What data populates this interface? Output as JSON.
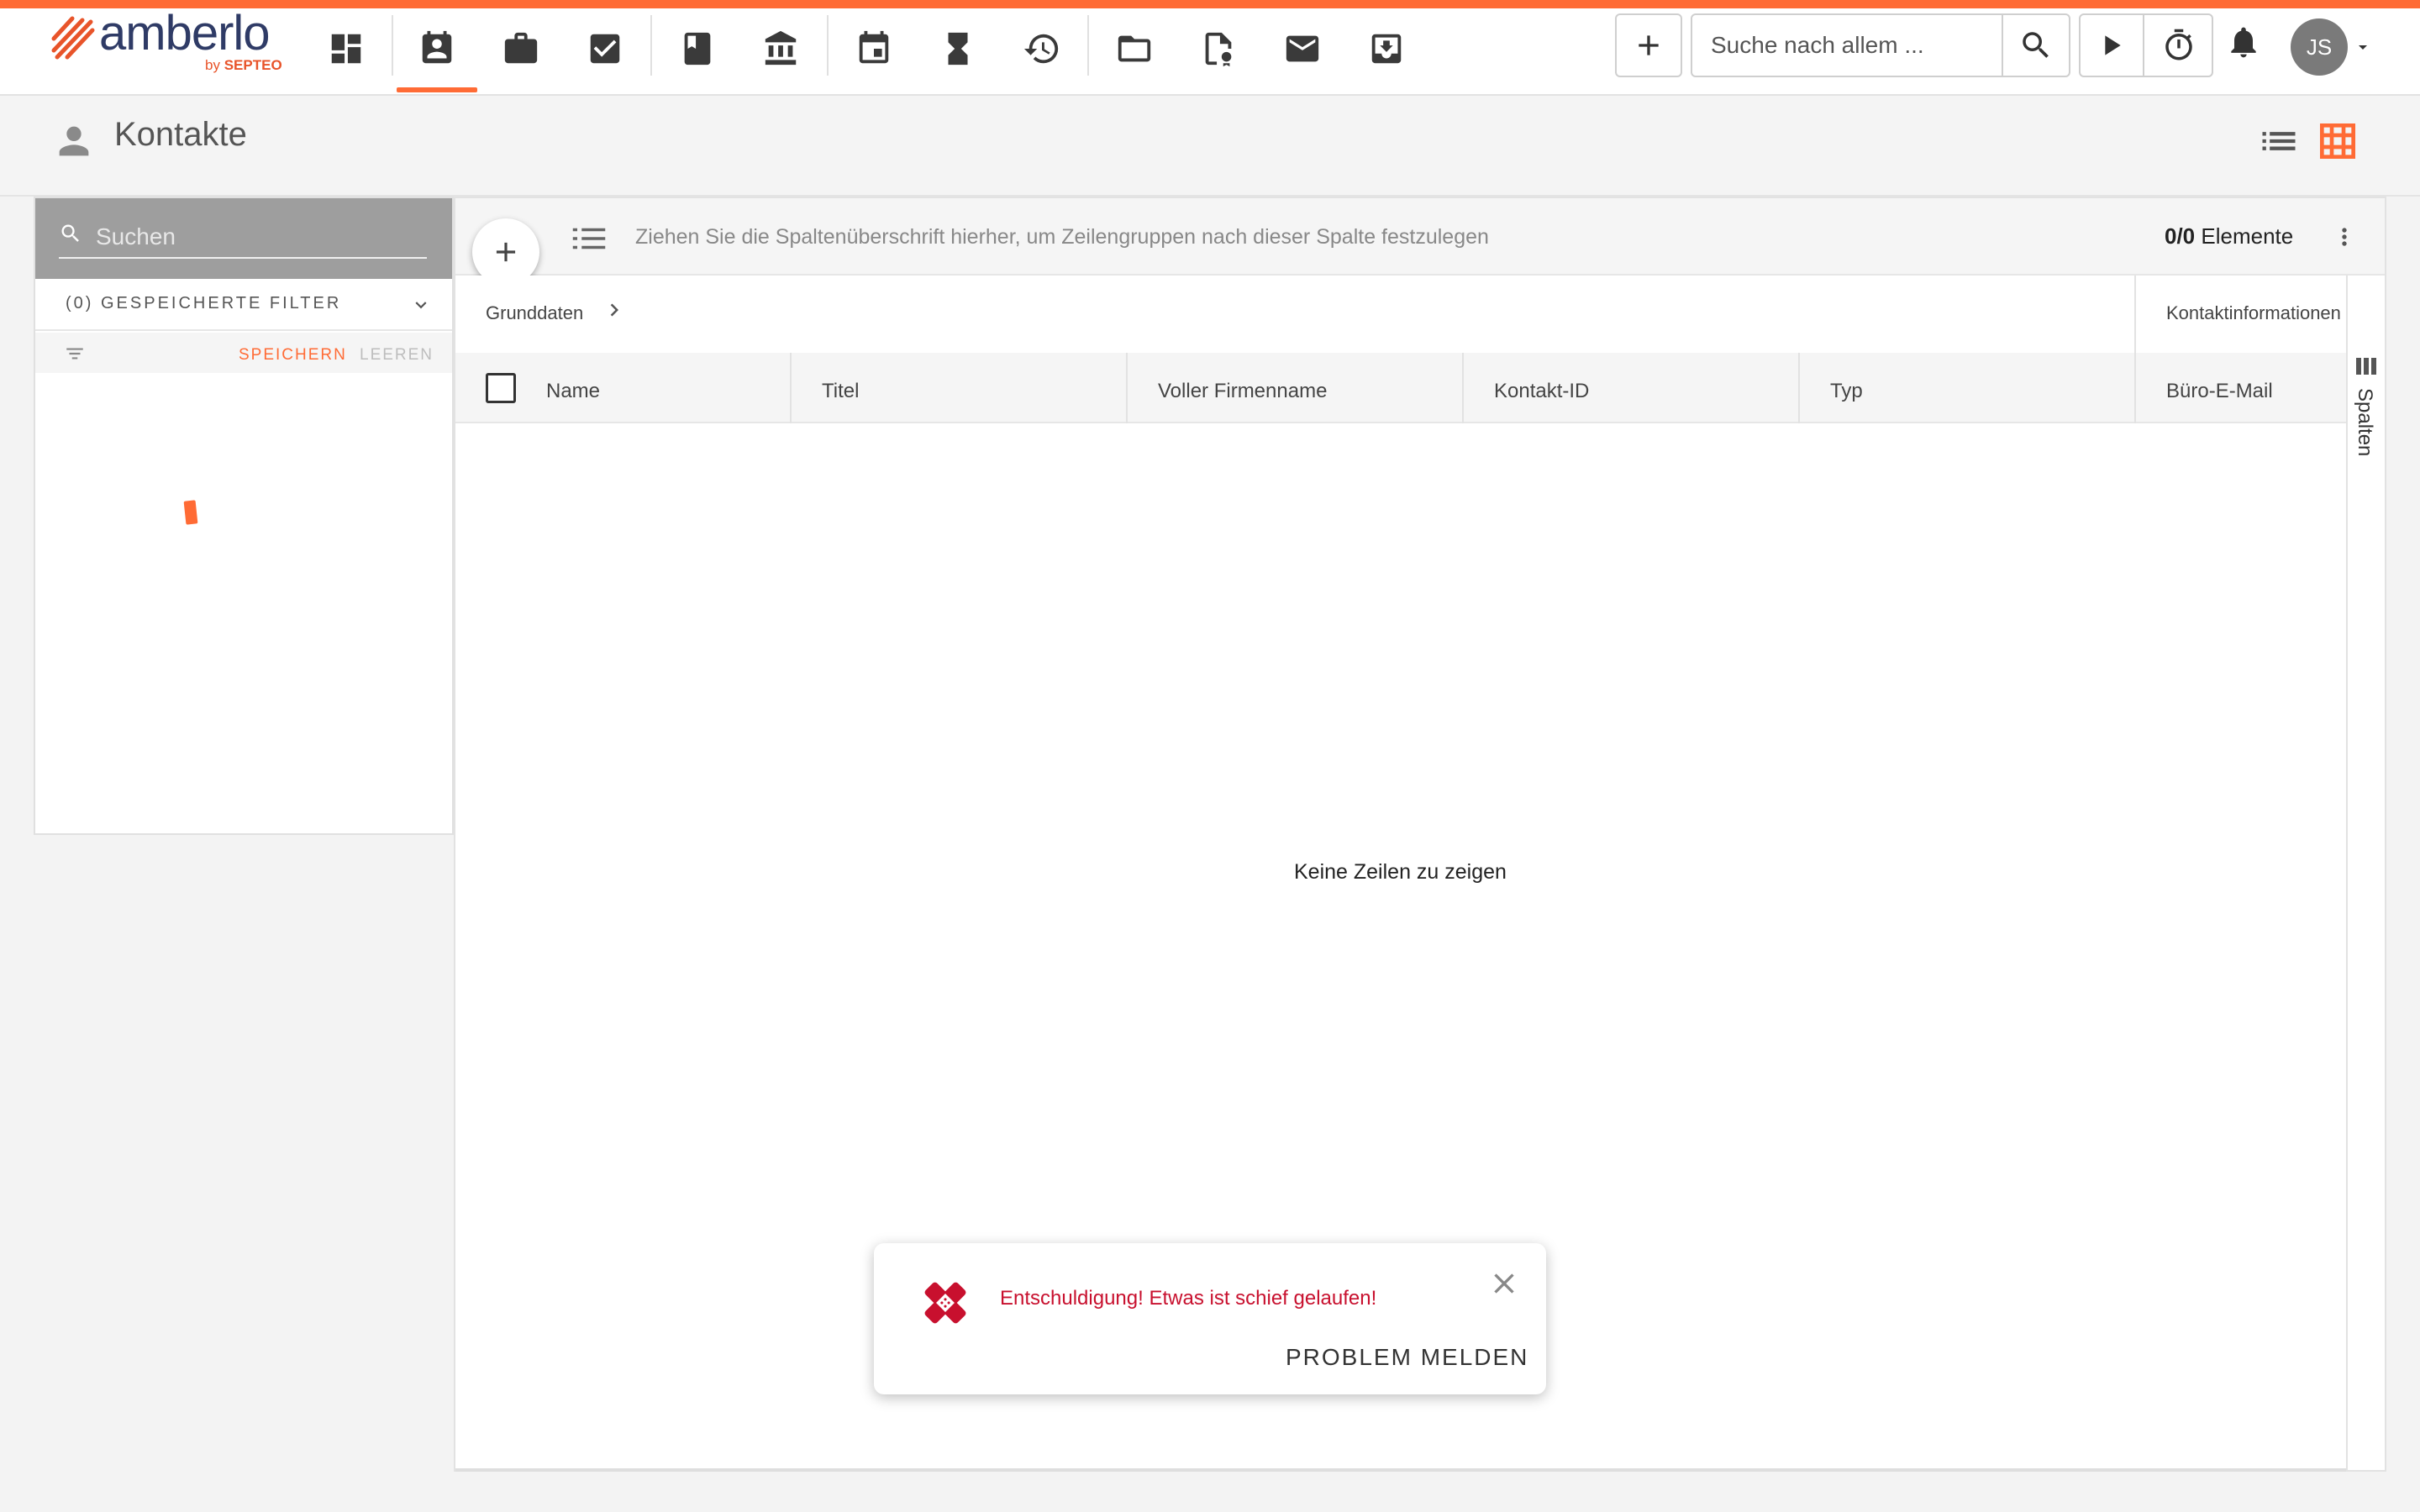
{
  "brand": {
    "name": "amberlo",
    "by": "by",
    "by_company": "SEPTEO",
    "accent": "#ff6b35",
    "navy": "#2f3b66"
  },
  "nav": {
    "items": [
      {
        "icon": "dashboard-icon"
      },
      {
        "icon": "contacts-icon",
        "active": true
      },
      {
        "icon": "briefcase-icon"
      },
      {
        "icon": "task-check-icon"
      },
      {
        "icon": "book-icon"
      },
      {
        "icon": "bank-icon"
      },
      {
        "icon": "calendar-icon"
      },
      {
        "icon": "hourglass-icon"
      },
      {
        "icon": "billing-history-icon"
      },
      {
        "icon": "folder-icon"
      },
      {
        "icon": "document-certificate-icon"
      },
      {
        "icon": "mail-icon"
      },
      {
        "icon": "inbox-download-icon"
      }
    ]
  },
  "toolbar": {
    "search_placeholder": "Suche nach allem ...",
    "user_initials": "JS"
  },
  "page": {
    "title": "Kontakte"
  },
  "filter": {
    "search_placeholder": "Suchen",
    "saved_filters_label": "(0) GESPEICHERTE FILTER",
    "save_label": "SPEICHERN",
    "clear_label": "LEEREN"
  },
  "grid": {
    "group_hint": "Ziehen Sie die Spaltenüberschrift hierher, um Zeilengruppen nach dieser Spalte festzulegen",
    "count": "0/0",
    "count_label": "Elemente",
    "column_groups": [
      "Grunddaten",
      "Kontaktinformationen"
    ],
    "columns": [
      "Name",
      "Titel",
      "Voller Firmenname",
      "Kontakt-ID",
      "Typ",
      "Büro-E-Mail"
    ],
    "empty_text": "Keine Zeilen zu zeigen",
    "side_panel_label": "Spalten"
  },
  "toast": {
    "message": "Entschuldigung! Etwas ist schief gelaufen!",
    "action": "PROBLEM MELDEN",
    "color": "#c8102e"
  }
}
